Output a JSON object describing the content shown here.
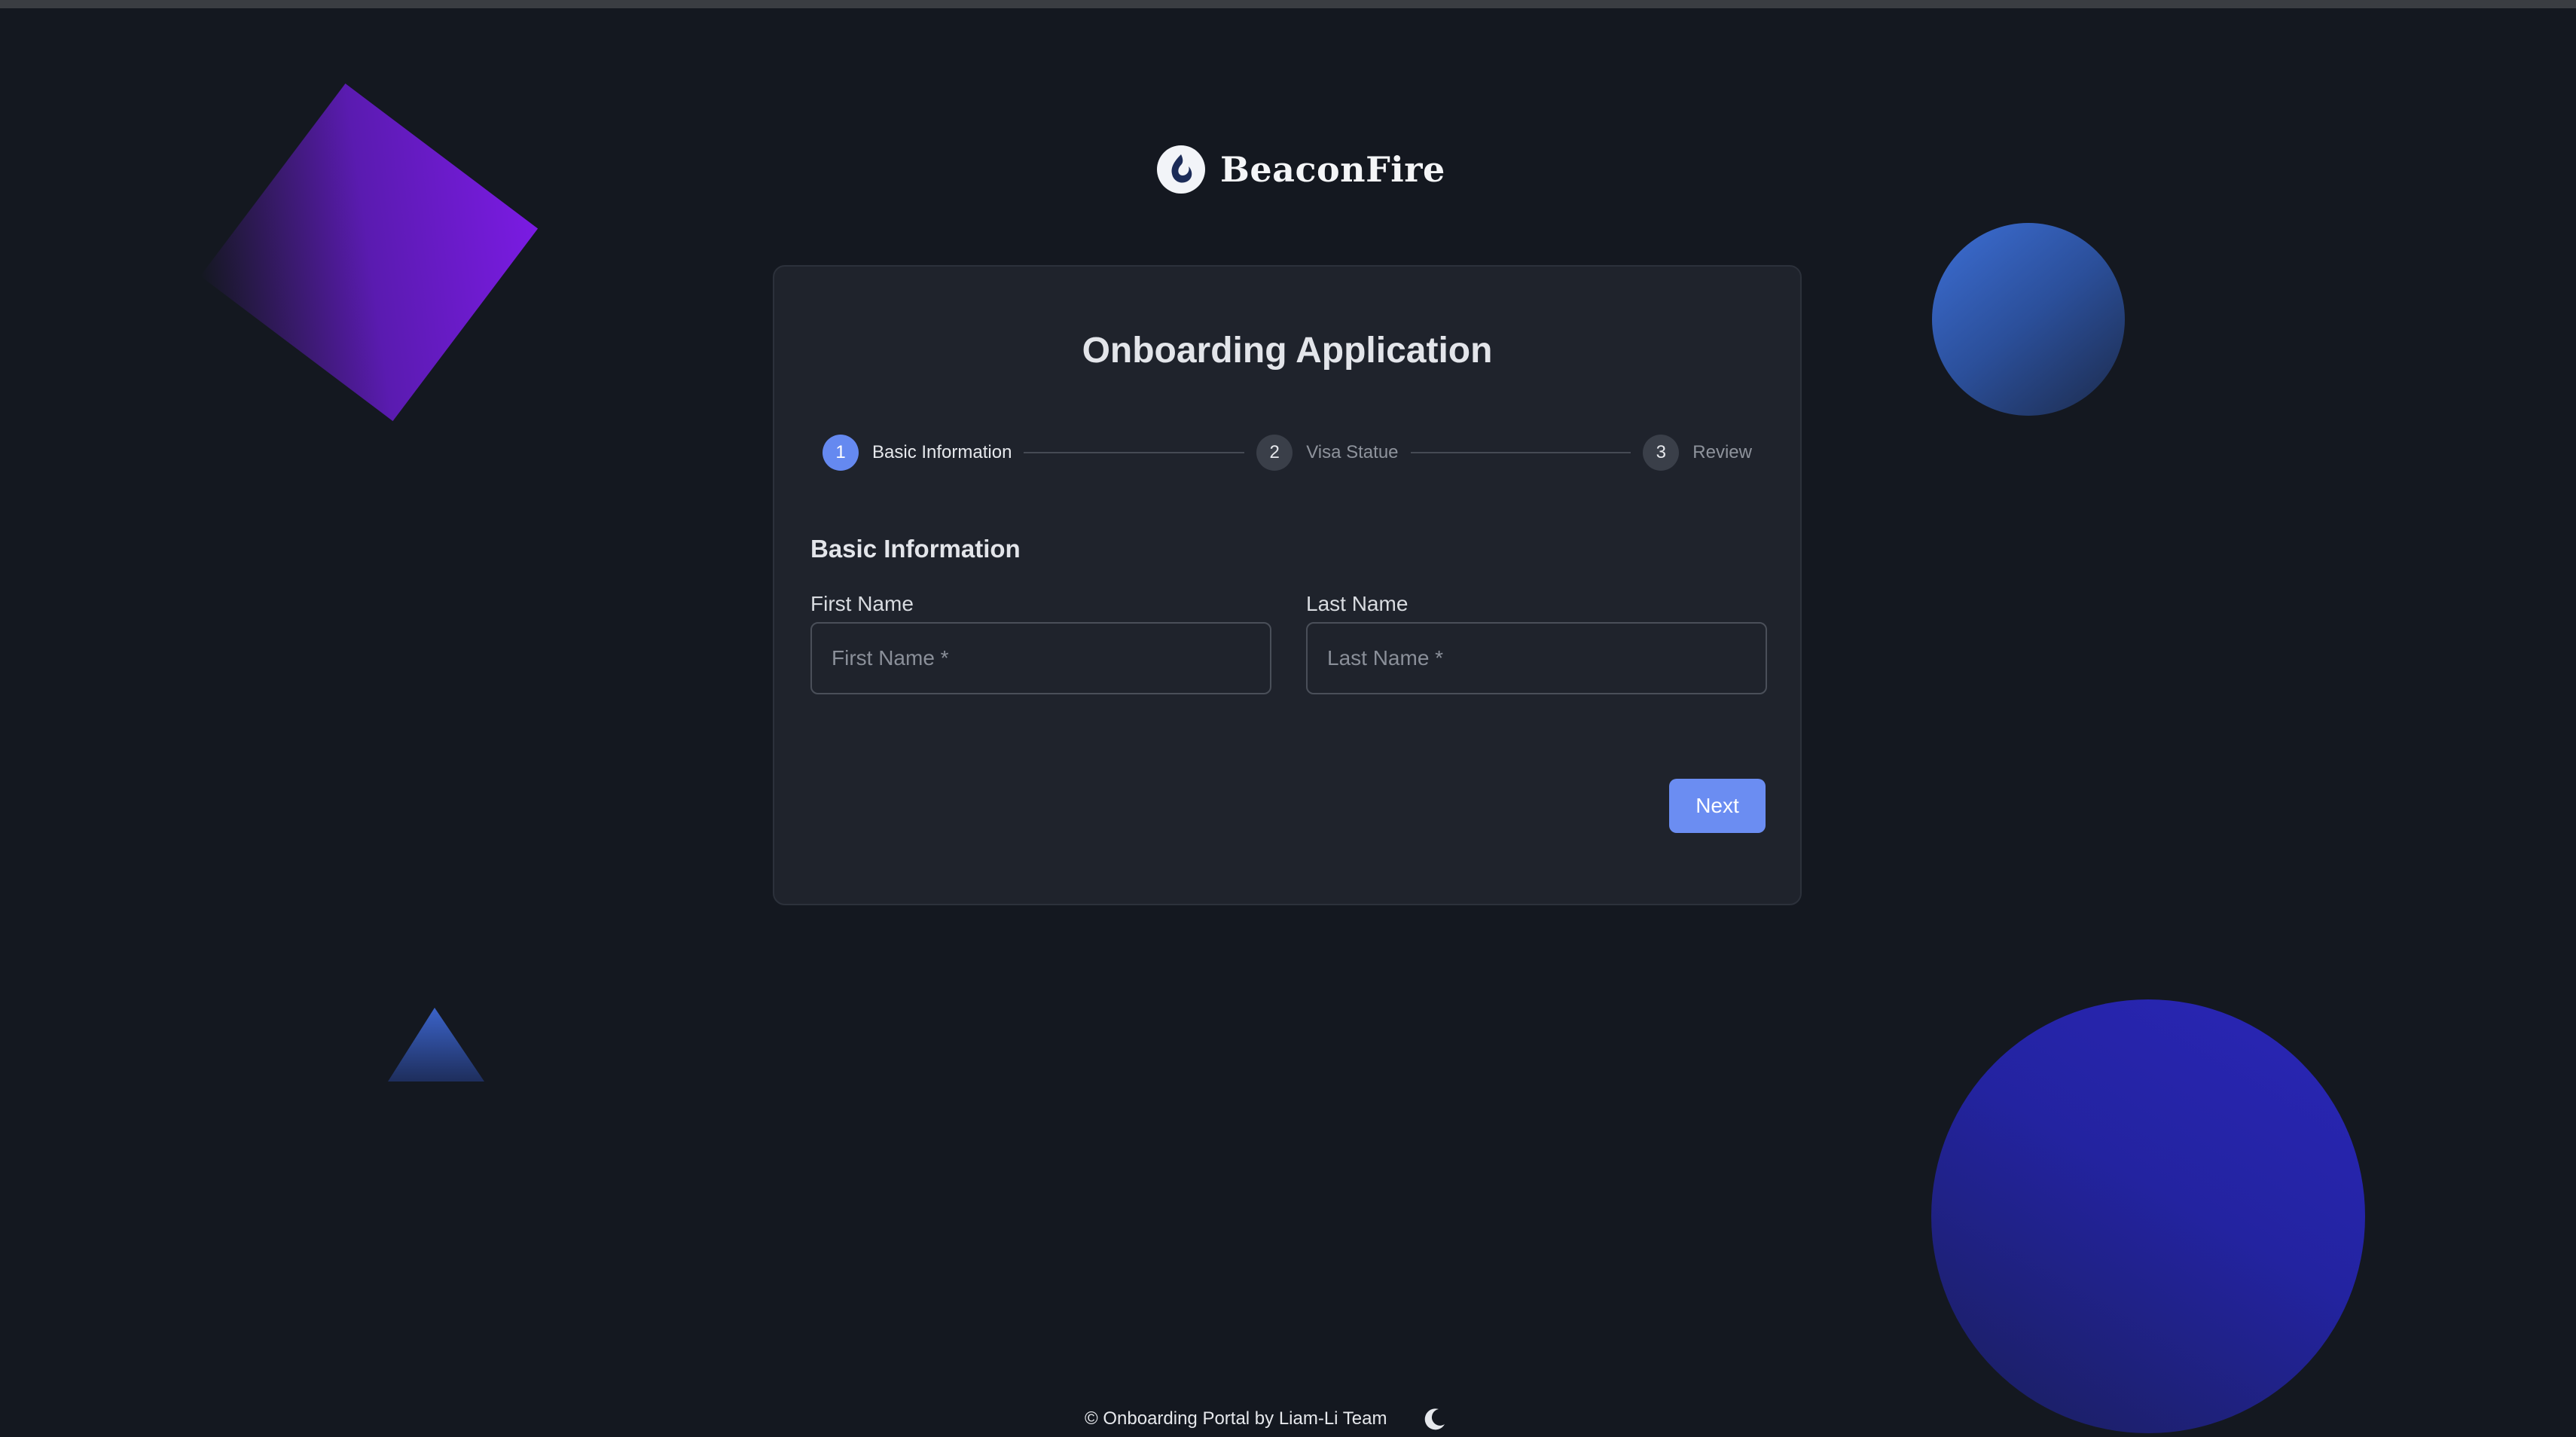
{
  "brand": {
    "name": "BeaconFire",
    "logo_icon": "flame-droplet-icon"
  },
  "form": {
    "title": "Onboarding Application",
    "steps": [
      {
        "number": "1",
        "label": "Basic Information",
        "state": "active"
      },
      {
        "number": "2",
        "label": "Visa Statue",
        "state": "inactive"
      },
      {
        "number": "3",
        "label": "Review",
        "state": "inactive"
      }
    ],
    "section_title": "Basic Information",
    "first_name": {
      "label": "First Name",
      "placeholder": "First Name *",
      "value": ""
    },
    "last_name": {
      "label": "Last Name",
      "placeholder": "Last Name *",
      "value": ""
    },
    "next_label": "Next"
  },
  "footer": {
    "text": "© Onboarding Portal by Liam-Li Team",
    "theme_toggle_icon": "moon-icon"
  },
  "colors": {
    "background": "#141820",
    "card": "#1f232c",
    "accent": "#6b8df2"
  }
}
